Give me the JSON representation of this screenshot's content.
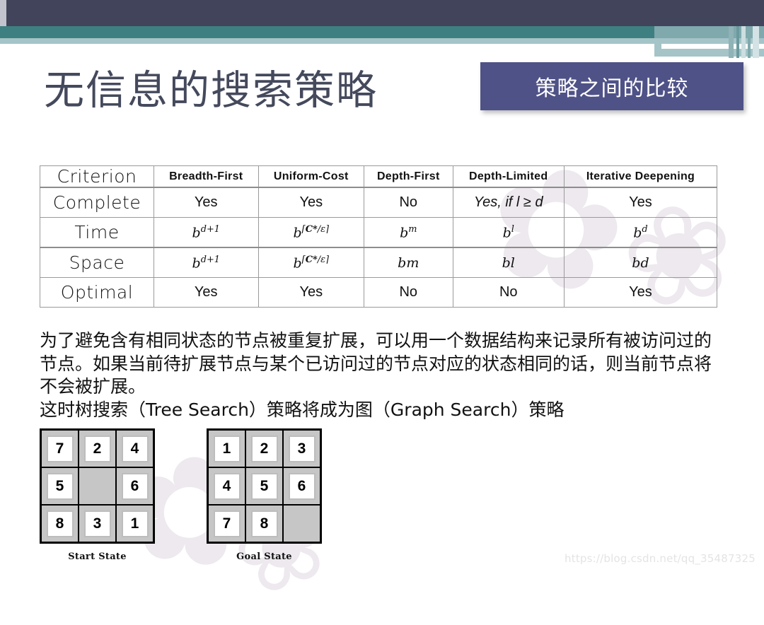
{
  "slide": {
    "title": "无信息的搜索策略",
    "badge_label": "策略之间的比较",
    "watermark_url": "https://blog.csdn.net/qq_35487325"
  },
  "comparison_table": {
    "columns": [
      "Criterion",
      "Breadth-First",
      "Uniform-Cost",
      "Depth-First",
      "Depth-Limited",
      "Iterative Deepening"
    ],
    "rows": [
      {
        "criterion": "Complete",
        "breadth_first": "Yes",
        "uniform_cost": "Yes",
        "depth_first": "No",
        "depth_limited": "Yes, if l ≥ d",
        "iterative_deepening": "Yes"
      },
      {
        "criterion": "Time",
        "breadth_first": "b^(d+1)",
        "uniform_cost": "b^⌈C*/ε⌉",
        "depth_first": "b^m",
        "depth_limited": "b^l",
        "iterative_deepening": "b^d"
      },
      {
        "criterion": "Space",
        "breadth_first": "b^(d+1)",
        "uniform_cost": "b^⌈C*/ε⌉",
        "depth_first": "bm",
        "depth_limited": "bl",
        "iterative_deepening": "bd"
      },
      {
        "criterion": "Optimal",
        "breadth_first": "Yes",
        "uniform_cost": "Yes",
        "depth_first": "No",
        "depth_limited": "No",
        "iterative_deepening": "Yes"
      }
    ]
  },
  "body_text": {
    "paragraph": "为了避免含有相同状态的节点被重复扩展，可以用一个数据结构来记录所有被访问过的节点。如果当前待扩展节点与某个已访问过的节点对应的状态相同的话，则当前节点将不会被扩展。",
    "line2": "这时树搜索（Tree Search）策略将成为图（Graph Search）策略"
  },
  "puzzles": [
    {
      "caption": "Start State",
      "tiles": [
        "7",
        "2",
        "4",
        "5",
        "",
        "6",
        "8",
        "3",
        "1"
      ]
    },
    {
      "caption": "Goal State",
      "tiles": [
        "1",
        "2",
        "3",
        "4",
        "5",
        "6",
        "7",
        "8",
        ""
      ]
    }
  ],
  "colors": {
    "banner_navy": "#41445a",
    "banner_teal": "#41827f",
    "banner_light_blue": "#a4c4c8",
    "badge_purple": "#4f5287",
    "title_text": "#44495c"
  }
}
